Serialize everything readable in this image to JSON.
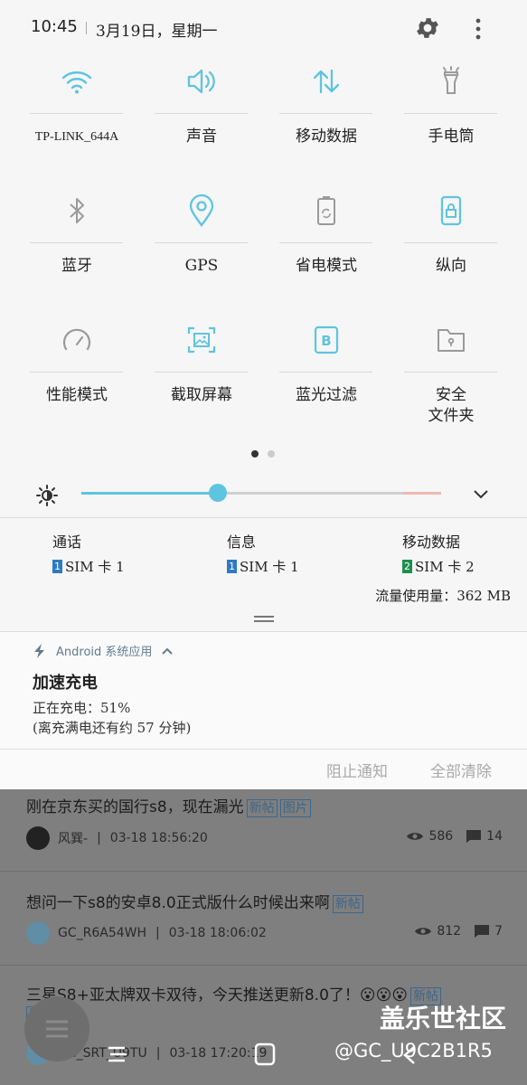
{
  "status": {
    "time": "10:45",
    "date": "3月19日，星期一"
  },
  "tiles": [
    {
      "label": "TP-LINK_644A",
      "icon": "wifi-icon"
    },
    {
      "label": "声音",
      "icon": "volume-icon"
    },
    {
      "label": "移动数据",
      "icon": "mobile-data-icon"
    },
    {
      "label": "手电筒",
      "icon": "flashlight-icon"
    },
    {
      "label": "蓝牙",
      "icon": "bluetooth-icon"
    },
    {
      "label": "GPS",
      "icon": "location-icon"
    },
    {
      "label": "省电模式",
      "icon": "battery-saver-icon"
    },
    {
      "label": "纵向",
      "icon": "portrait-lock-icon"
    },
    {
      "label": "性能模式",
      "icon": "performance-icon"
    },
    {
      "label": "截取屏幕",
      "icon": "screenshot-icon"
    },
    {
      "label": "蓝光过滤",
      "icon": "blue-light-filter-icon"
    },
    {
      "label": "安全\n文件夹",
      "icon": "secure-folder-icon"
    }
  ],
  "brightness": {
    "level": 0.38
  },
  "sim": {
    "call": {
      "title": "通话",
      "badge": "1",
      "label": "SIM 卡 1"
    },
    "message": {
      "title": "信息",
      "badge": "1",
      "label": "SIM 卡 1"
    },
    "data": {
      "title": "移动数据",
      "badge": "2",
      "label": "SIM 卡 2"
    },
    "usage": "流量使用量：362 MB"
  },
  "notification": {
    "app": "Android 系统应用",
    "title": "加速充电",
    "line1": "正在充电：51%",
    "line2": "(离充满电还有约 57 分钟)",
    "block": "阻止通知",
    "clear": "全部清除"
  },
  "posts": [
    {
      "title": "刚在京东买的国行s8，现在漏光",
      "tags": [
        "新帖",
        "图片"
      ],
      "user": "风巽-",
      "time": "03-18 18:56:20",
      "views": "586",
      "comments": "14"
    },
    {
      "title": "想问一下s8的安卓8.0正式版什么时候出来啊",
      "tags": [
        "新帖"
      ],
      "user": "GC_R6A54WH",
      "time": "03-18 18:06:02",
      "views": "812",
      "comments": "7"
    },
    {
      "title": "三星S8+亚太牌双卡双待，今天推送更新8.0了！😮😮😮",
      "tags": [
        "新帖",
        "图片"
      ],
      "user": "GC_SRT_U9TU",
      "time": "03-18 17:20:19"
    }
  ],
  "watermark": {
    "site": "盖乐世社区",
    "user": "@GC_U9C2B1R5"
  },
  "colors": {
    "accent": "#5ec4e0",
    "sim1": "#2e7bc2",
    "sim2": "#1e8f4e"
  }
}
